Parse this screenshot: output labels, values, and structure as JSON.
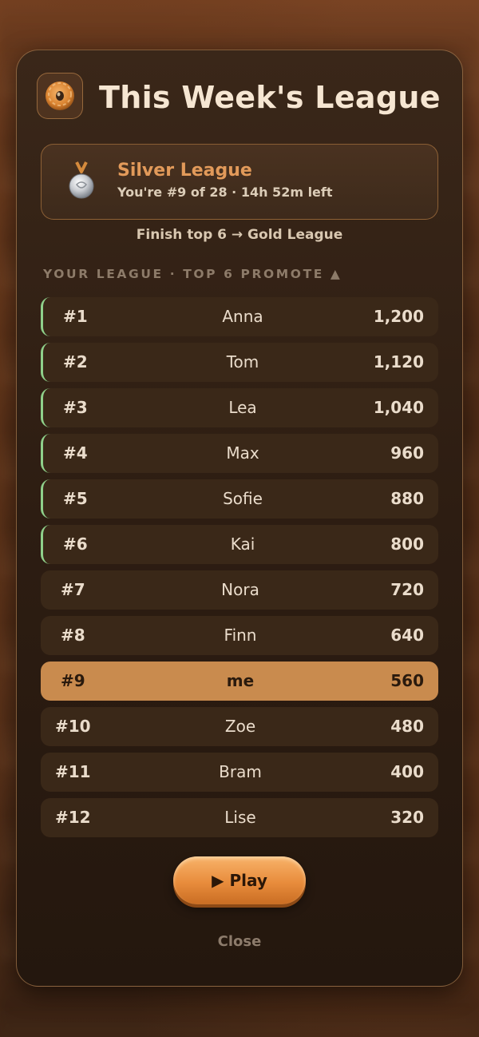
{
  "header": {
    "title": "This Week's League",
    "icon": "donut-icon"
  },
  "league": {
    "name": "Silver League",
    "status": "You're #9 of 28 · 14h 52m left",
    "icon": "silver-medal-icon",
    "promotion_text": "Finish top 6 → Gold League"
  },
  "section": {
    "heading": "YOUR LEAGUE · TOP 6 PROMOTE ▲"
  },
  "leaderboard": [
    {
      "rank": "#1",
      "name": "Anna",
      "score": "1,200"
    },
    {
      "rank": "#2",
      "name": "Tom",
      "score": "1,120"
    },
    {
      "rank": "#3",
      "name": "Lea",
      "score": "1,040"
    },
    {
      "rank": "#4",
      "name": "Max",
      "score": "960"
    },
    {
      "rank": "#5",
      "name": "Sofie",
      "score": "880"
    },
    {
      "rank": "#6",
      "name": "Kai",
      "score": "800"
    },
    {
      "rank": "#7",
      "name": "Nora",
      "score": "720"
    },
    {
      "rank": "#8",
      "name": "Finn",
      "score": "640"
    },
    {
      "rank": "#9",
      "name": "me",
      "score": "560"
    },
    {
      "rank": "#10",
      "name": "Zoe",
      "score": "480"
    },
    {
      "rank": "#11",
      "name": "Bram",
      "score": "400"
    },
    {
      "rank": "#12",
      "name": "Lise",
      "score": "320"
    }
  ],
  "actions": {
    "play_label": "▶ Play",
    "close_label": "Close"
  },
  "colors": {
    "accent": "#e29a5a",
    "promote_marker": "#8fd08a",
    "highlight_row": "#c98b4e"
  }
}
